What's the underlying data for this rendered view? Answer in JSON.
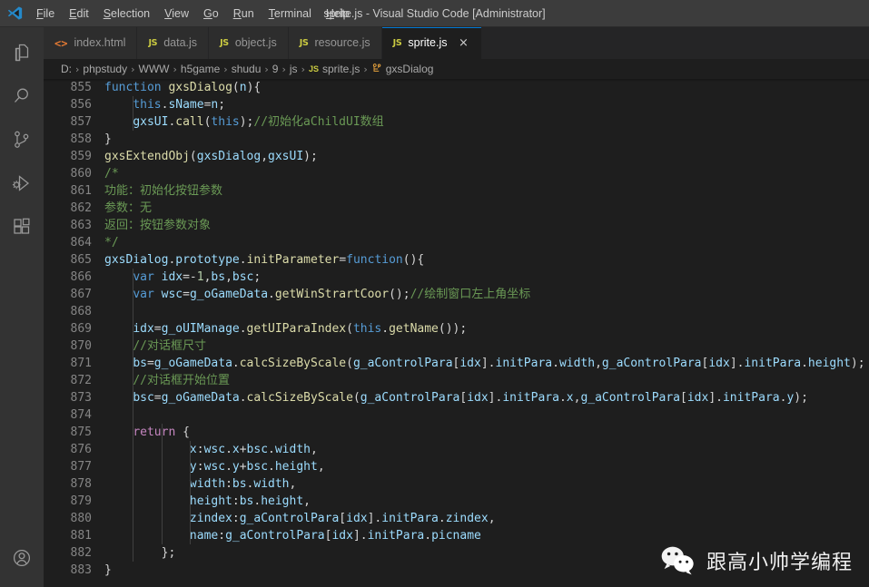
{
  "window": {
    "title": "sprite.js - Visual Studio Code [Administrator]",
    "logo_icon": "vscode-logo-icon"
  },
  "menubar": {
    "items": [
      {
        "label": "File",
        "mnemonic": "F",
        "rest": "ile"
      },
      {
        "label": "Edit",
        "mnemonic": "E",
        "rest": "dit"
      },
      {
        "label": "Selection",
        "mnemonic": "S",
        "rest": "election"
      },
      {
        "label": "View",
        "mnemonic": "V",
        "rest": "iew"
      },
      {
        "label": "Go",
        "mnemonic": "G",
        "rest": "o"
      },
      {
        "label": "Run",
        "mnemonic": "R",
        "rest": "un"
      },
      {
        "label": "Terminal",
        "mnemonic": "T",
        "rest": "erminal"
      },
      {
        "label": "Help",
        "mnemonic": "H",
        "rest": "elp"
      }
    ]
  },
  "activitybar": {
    "items": [
      {
        "name": "explorer-icon",
        "title": "Explorer"
      },
      {
        "name": "search-icon",
        "title": "Search"
      },
      {
        "name": "source-control-icon",
        "title": "Source Control"
      },
      {
        "name": "run-and-debug-icon",
        "title": "Run and Debug"
      },
      {
        "name": "extensions-icon",
        "title": "Extensions"
      }
    ],
    "bottom_items": [
      {
        "name": "account-icon",
        "title": "Accounts"
      }
    ]
  },
  "tabs": {
    "items": [
      {
        "label": "index.html",
        "icon": "html-file-icon",
        "icon_glyph": "<>",
        "icon_kind": "html",
        "active": false
      },
      {
        "label": "data.js",
        "icon": "js-file-icon",
        "icon_glyph": "JS",
        "icon_kind": "js",
        "active": false
      },
      {
        "label": "object.js",
        "icon": "js-file-icon",
        "icon_glyph": "JS",
        "icon_kind": "js",
        "active": false
      },
      {
        "label": "resource.js",
        "icon": "js-file-icon",
        "icon_glyph": "JS",
        "icon_kind": "js",
        "active": false
      },
      {
        "label": "sprite.js",
        "icon": "js-file-icon",
        "icon_glyph": "JS",
        "icon_kind": "js",
        "active": true
      }
    ],
    "close_glyph": "×"
  },
  "breadcrumb": {
    "separator": "›",
    "segments": [
      {
        "label": "D:",
        "icon": null
      },
      {
        "label": "phpstudy",
        "icon": null
      },
      {
        "label": "WWW",
        "icon": null
      },
      {
        "label": "h5game",
        "icon": null
      },
      {
        "label": "shudu",
        "icon": null
      },
      {
        "label": "9",
        "icon": null
      },
      {
        "label": "js",
        "icon": null
      },
      {
        "label": "sprite.js",
        "icon": "js-file-icon",
        "icon_glyph": "JS",
        "icon_kind": "js"
      },
      {
        "label": "gxsDialog",
        "icon": "class-symbol-icon",
        "icon_glyph": "⚇",
        "icon_kind": "sym"
      }
    ]
  },
  "editor": {
    "first_line_number": 855,
    "language": "javascript",
    "lines": [
      {
        "n": 855,
        "tokens": [
          {
            "t": "function",
            "c": "t-kw"
          },
          {
            "t": " ",
            "c": "t-plain"
          },
          {
            "t": "gxsDialog",
            "c": "t-fn"
          },
          {
            "t": "(",
            "c": "t-plain"
          },
          {
            "t": "n",
            "c": "t-var"
          },
          {
            "t": "){",
            "c": "t-plain"
          }
        ]
      },
      {
        "n": 856,
        "tokens": [
          {
            "t": "    ",
            "c": "t-plain"
          },
          {
            "t": "this",
            "c": "t-this"
          },
          {
            "t": ".",
            "c": "t-plain"
          },
          {
            "t": "sName",
            "c": "t-prop"
          },
          {
            "t": "=",
            "c": "t-plain"
          },
          {
            "t": "n",
            "c": "t-var"
          },
          {
            "t": ";",
            "c": "t-plain"
          }
        ]
      },
      {
        "n": 857,
        "tokens": [
          {
            "t": "    ",
            "c": "t-plain"
          },
          {
            "t": "gxsUI",
            "c": "t-var"
          },
          {
            "t": ".",
            "c": "t-plain"
          },
          {
            "t": "call",
            "c": "t-fn"
          },
          {
            "t": "(",
            "c": "t-plain"
          },
          {
            "t": "this",
            "c": "t-this"
          },
          {
            "t": ");",
            "c": "t-plain"
          },
          {
            "t": "//初始化aChildUI数组",
            "c": "t-com"
          }
        ]
      },
      {
        "n": 858,
        "tokens": [
          {
            "t": "}",
            "c": "t-plain"
          }
        ]
      },
      {
        "n": 859,
        "tokens": [
          {
            "t": "gxsExtendObj",
            "c": "t-fn"
          },
          {
            "t": "(",
            "c": "t-plain"
          },
          {
            "t": "gxsDialog",
            "c": "t-var"
          },
          {
            "t": ",",
            "c": "t-plain"
          },
          {
            "t": "gxsUI",
            "c": "t-var"
          },
          {
            "t": ");",
            "c": "t-plain"
          }
        ]
      },
      {
        "n": 860,
        "tokens": [
          {
            "t": "/*",
            "c": "t-com"
          }
        ]
      },
      {
        "n": 861,
        "tokens": [
          {
            "t": "功能：初始化按钮参数",
            "c": "t-com"
          }
        ]
      },
      {
        "n": 862,
        "tokens": [
          {
            "t": "参数：无",
            "c": "t-com"
          }
        ]
      },
      {
        "n": 863,
        "tokens": [
          {
            "t": "返回：按钮参数对象",
            "c": "t-com"
          }
        ]
      },
      {
        "n": 864,
        "tokens": [
          {
            "t": "*/",
            "c": "t-com"
          }
        ]
      },
      {
        "n": 865,
        "tokens": [
          {
            "t": "gxsDialog",
            "c": "t-var"
          },
          {
            "t": ".",
            "c": "t-plain"
          },
          {
            "t": "prototype",
            "c": "t-prop"
          },
          {
            "t": ".",
            "c": "t-plain"
          },
          {
            "t": "initParameter",
            "c": "t-fn"
          },
          {
            "t": "=",
            "c": "t-plain"
          },
          {
            "t": "function",
            "c": "t-kw"
          },
          {
            "t": "(){",
            "c": "t-plain"
          }
        ]
      },
      {
        "n": 866,
        "tokens": [
          {
            "t": "    ",
            "c": "t-plain"
          },
          {
            "t": "var",
            "c": "t-kw"
          },
          {
            "t": " ",
            "c": "t-plain"
          },
          {
            "t": "idx",
            "c": "t-var"
          },
          {
            "t": "=-",
            "c": "t-plain"
          },
          {
            "t": "1",
            "c": "t-num"
          },
          {
            "t": ",",
            "c": "t-plain"
          },
          {
            "t": "bs",
            "c": "t-var"
          },
          {
            "t": ",",
            "c": "t-plain"
          },
          {
            "t": "bsc",
            "c": "t-var"
          },
          {
            "t": ";",
            "c": "t-plain"
          }
        ]
      },
      {
        "n": 867,
        "tokens": [
          {
            "t": "    ",
            "c": "t-plain"
          },
          {
            "t": "var",
            "c": "t-kw"
          },
          {
            "t": " ",
            "c": "t-plain"
          },
          {
            "t": "wsc",
            "c": "t-var"
          },
          {
            "t": "=",
            "c": "t-plain"
          },
          {
            "t": "g_oGameData",
            "c": "t-var"
          },
          {
            "t": ".",
            "c": "t-plain"
          },
          {
            "t": "getWinStrartCoor",
            "c": "t-fn"
          },
          {
            "t": "();",
            "c": "t-plain"
          },
          {
            "t": "//绘制窗口左上角坐标",
            "c": "t-com"
          }
        ]
      },
      {
        "n": 868,
        "tokens": []
      },
      {
        "n": 869,
        "tokens": [
          {
            "t": "    ",
            "c": "t-plain"
          },
          {
            "t": "idx",
            "c": "t-var"
          },
          {
            "t": "=",
            "c": "t-plain"
          },
          {
            "t": "g_oUIManage",
            "c": "t-var"
          },
          {
            "t": ".",
            "c": "t-plain"
          },
          {
            "t": "getUIParaIndex",
            "c": "t-fn"
          },
          {
            "t": "(",
            "c": "t-plain"
          },
          {
            "t": "this",
            "c": "t-this"
          },
          {
            "t": ".",
            "c": "t-plain"
          },
          {
            "t": "getName",
            "c": "t-fn"
          },
          {
            "t": "());",
            "c": "t-plain"
          }
        ]
      },
      {
        "n": 870,
        "tokens": [
          {
            "t": "    ",
            "c": "t-plain"
          },
          {
            "t": "//对话框尺寸",
            "c": "t-com"
          }
        ]
      },
      {
        "n": 871,
        "tokens": [
          {
            "t": "    ",
            "c": "t-plain"
          },
          {
            "t": "bs",
            "c": "t-var"
          },
          {
            "t": "=",
            "c": "t-plain"
          },
          {
            "t": "g_oGameData",
            "c": "t-var"
          },
          {
            "t": ".",
            "c": "t-plain"
          },
          {
            "t": "calcSizeByScale",
            "c": "t-fn"
          },
          {
            "t": "(",
            "c": "t-plain"
          },
          {
            "t": "g_aControlPara",
            "c": "t-var"
          },
          {
            "t": "[",
            "c": "t-plain"
          },
          {
            "t": "idx",
            "c": "t-var"
          },
          {
            "t": "].",
            "c": "t-plain"
          },
          {
            "t": "initPara",
            "c": "t-prop"
          },
          {
            "t": ".",
            "c": "t-plain"
          },
          {
            "t": "width",
            "c": "t-prop"
          },
          {
            "t": ",",
            "c": "t-plain"
          },
          {
            "t": "g_aControlPara",
            "c": "t-var"
          },
          {
            "t": "[",
            "c": "t-plain"
          },
          {
            "t": "idx",
            "c": "t-var"
          },
          {
            "t": "].",
            "c": "t-plain"
          },
          {
            "t": "initPara",
            "c": "t-prop"
          },
          {
            "t": ".",
            "c": "t-plain"
          },
          {
            "t": "height",
            "c": "t-prop"
          },
          {
            "t": ");",
            "c": "t-plain"
          }
        ]
      },
      {
        "n": 872,
        "tokens": [
          {
            "t": "    ",
            "c": "t-plain"
          },
          {
            "t": "//对话框开始位置",
            "c": "t-com"
          }
        ]
      },
      {
        "n": 873,
        "tokens": [
          {
            "t": "    ",
            "c": "t-plain"
          },
          {
            "t": "bsc",
            "c": "t-var"
          },
          {
            "t": "=",
            "c": "t-plain"
          },
          {
            "t": "g_oGameData",
            "c": "t-var"
          },
          {
            "t": ".",
            "c": "t-plain"
          },
          {
            "t": "calcSizeByScale",
            "c": "t-fn"
          },
          {
            "t": "(",
            "c": "t-plain"
          },
          {
            "t": "g_aControlPara",
            "c": "t-var"
          },
          {
            "t": "[",
            "c": "t-plain"
          },
          {
            "t": "idx",
            "c": "t-var"
          },
          {
            "t": "].",
            "c": "t-plain"
          },
          {
            "t": "initPara",
            "c": "t-prop"
          },
          {
            "t": ".",
            "c": "t-plain"
          },
          {
            "t": "x",
            "c": "t-prop"
          },
          {
            "t": ",",
            "c": "t-plain"
          },
          {
            "t": "g_aControlPara",
            "c": "t-var"
          },
          {
            "t": "[",
            "c": "t-plain"
          },
          {
            "t": "idx",
            "c": "t-var"
          },
          {
            "t": "].",
            "c": "t-plain"
          },
          {
            "t": "initPara",
            "c": "t-prop"
          },
          {
            "t": ".",
            "c": "t-plain"
          },
          {
            "t": "y",
            "c": "t-prop"
          },
          {
            "t": ");",
            "c": "t-plain"
          }
        ]
      },
      {
        "n": 874,
        "tokens": []
      },
      {
        "n": 875,
        "tokens": [
          {
            "t": "    ",
            "c": "t-plain"
          },
          {
            "t": "return",
            "c": "t-kw2"
          },
          {
            "t": " {",
            "c": "t-plain"
          }
        ]
      },
      {
        "n": 876,
        "tokens": [
          {
            "t": "            ",
            "c": "t-plain"
          },
          {
            "t": "x",
            "c": "t-prop"
          },
          {
            "t": ":",
            "c": "t-plain"
          },
          {
            "t": "wsc",
            "c": "t-var"
          },
          {
            "t": ".",
            "c": "t-plain"
          },
          {
            "t": "x",
            "c": "t-prop"
          },
          {
            "t": "+",
            "c": "t-plain"
          },
          {
            "t": "bsc",
            "c": "t-var"
          },
          {
            "t": ".",
            "c": "t-plain"
          },
          {
            "t": "width",
            "c": "t-prop"
          },
          {
            "t": ",",
            "c": "t-plain"
          }
        ]
      },
      {
        "n": 877,
        "tokens": [
          {
            "t": "            ",
            "c": "t-plain"
          },
          {
            "t": "y",
            "c": "t-prop"
          },
          {
            "t": ":",
            "c": "t-plain"
          },
          {
            "t": "wsc",
            "c": "t-var"
          },
          {
            "t": ".",
            "c": "t-plain"
          },
          {
            "t": "y",
            "c": "t-prop"
          },
          {
            "t": "+",
            "c": "t-plain"
          },
          {
            "t": "bsc",
            "c": "t-var"
          },
          {
            "t": ".",
            "c": "t-plain"
          },
          {
            "t": "height",
            "c": "t-prop"
          },
          {
            "t": ",",
            "c": "t-plain"
          }
        ]
      },
      {
        "n": 878,
        "tokens": [
          {
            "t": "            ",
            "c": "t-plain"
          },
          {
            "t": "width",
            "c": "t-prop"
          },
          {
            "t": ":",
            "c": "t-plain"
          },
          {
            "t": "bs",
            "c": "t-var"
          },
          {
            "t": ".",
            "c": "t-plain"
          },
          {
            "t": "width",
            "c": "t-prop"
          },
          {
            "t": ",",
            "c": "t-plain"
          }
        ]
      },
      {
        "n": 879,
        "tokens": [
          {
            "t": "            ",
            "c": "t-plain"
          },
          {
            "t": "height",
            "c": "t-prop"
          },
          {
            "t": ":",
            "c": "t-plain"
          },
          {
            "t": "bs",
            "c": "t-var"
          },
          {
            "t": ".",
            "c": "t-plain"
          },
          {
            "t": "height",
            "c": "t-prop"
          },
          {
            "t": ",",
            "c": "t-plain"
          }
        ]
      },
      {
        "n": 880,
        "tokens": [
          {
            "t": "            ",
            "c": "t-plain"
          },
          {
            "t": "zindex",
            "c": "t-prop"
          },
          {
            "t": ":",
            "c": "t-plain"
          },
          {
            "t": "g_aControlPara",
            "c": "t-var"
          },
          {
            "t": "[",
            "c": "t-plain"
          },
          {
            "t": "idx",
            "c": "t-var"
          },
          {
            "t": "].",
            "c": "t-plain"
          },
          {
            "t": "initPara",
            "c": "t-prop"
          },
          {
            "t": ".",
            "c": "t-plain"
          },
          {
            "t": "zindex",
            "c": "t-prop"
          },
          {
            "t": ",",
            "c": "t-plain"
          }
        ]
      },
      {
        "n": 881,
        "tokens": [
          {
            "t": "            ",
            "c": "t-plain"
          },
          {
            "t": "name",
            "c": "t-prop"
          },
          {
            "t": ":",
            "c": "t-plain"
          },
          {
            "t": "g_aControlPara",
            "c": "t-var"
          },
          {
            "t": "[",
            "c": "t-plain"
          },
          {
            "t": "idx",
            "c": "t-var"
          },
          {
            "t": "].",
            "c": "t-plain"
          },
          {
            "t": "initPara",
            "c": "t-prop"
          },
          {
            "t": ".",
            "c": "t-plain"
          },
          {
            "t": "picname",
            "c": "t-prop"
          }
        ]
      },
      {
        "n": 882,
        "tokens": [
          {
            "t": "        ",
            "c": "t-plain"
          },
          {
            "t": "};",
            "c": "t-plain"
          }
        ]
      },
      {
        "n": 883,
        "tokens": [
          {
            "t": "}",
            "c": "t-plain"
          }
        ]
      }
    ]
  },
  "watermark": {
    "text": "跟高小帅学编程",
    "logo_icon": "wechat-logo-icon"
  },
  "colors": {
    "titlebar_bg": "#3c3c3c",
    "activitybar_bg": "#333333",
    "tabbar_bg": "#252526",
    "tab_inactive_bg": "#2d2d2d",
    "editor_bg": "#1e1e1e",
    "accent": "#0078d4",
    "js_icon": "#cbcb41",
    "html_icon": "#e37933",
    "symbol_icon": "#e8a33d",
    "comment": "#6a9955",
    "keyword": "#569cd6",
    "control_keyword": "#c586c0",
    "function": "#dcdcaa",
    "variable": "#9cdcfe",
    "number": "#b5cea8",
    "plain_text": "#d4d4d4",
    "line_number": "#858585"
  }
}
